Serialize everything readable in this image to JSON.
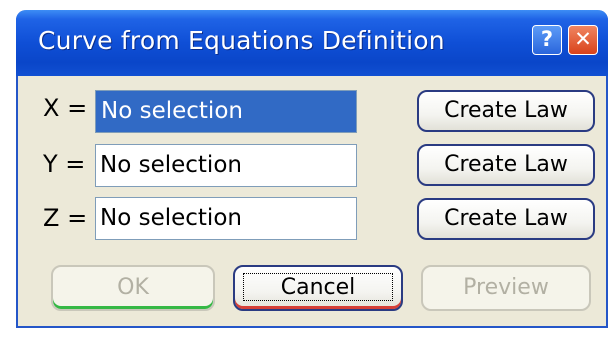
{
  "window": {
    "title": "Curve from Equations Definition",
    "help_symbol": "?",
    "close_symbol": "✕"
  },
  "rows": [
    {
      "axis_label": "X =",
      "value": "No selection",
      "selected": true,
      "law_button": "Create Law"
    },
    {
      "axis_label": "Y =",
      "value": "No selection",
      "selected": false,
      "law_button": "Create Law"
    },
    {
      "axis_label": "Z =",
      "value": "No selection",
      "selected": false,
      "law_button": "Create Law"
    }
  ],
  "buttons": {
    "ok": "OK",
    "cancel": "Cancel",
    "preview": "Preview"
  },
  "colors": {
    "title_bar": "#0a46c9",
    "selection": "#316ac5",
    "dialog_bg": "#ece9d8",
    "button_border": "#2a3b82"
  }
}
